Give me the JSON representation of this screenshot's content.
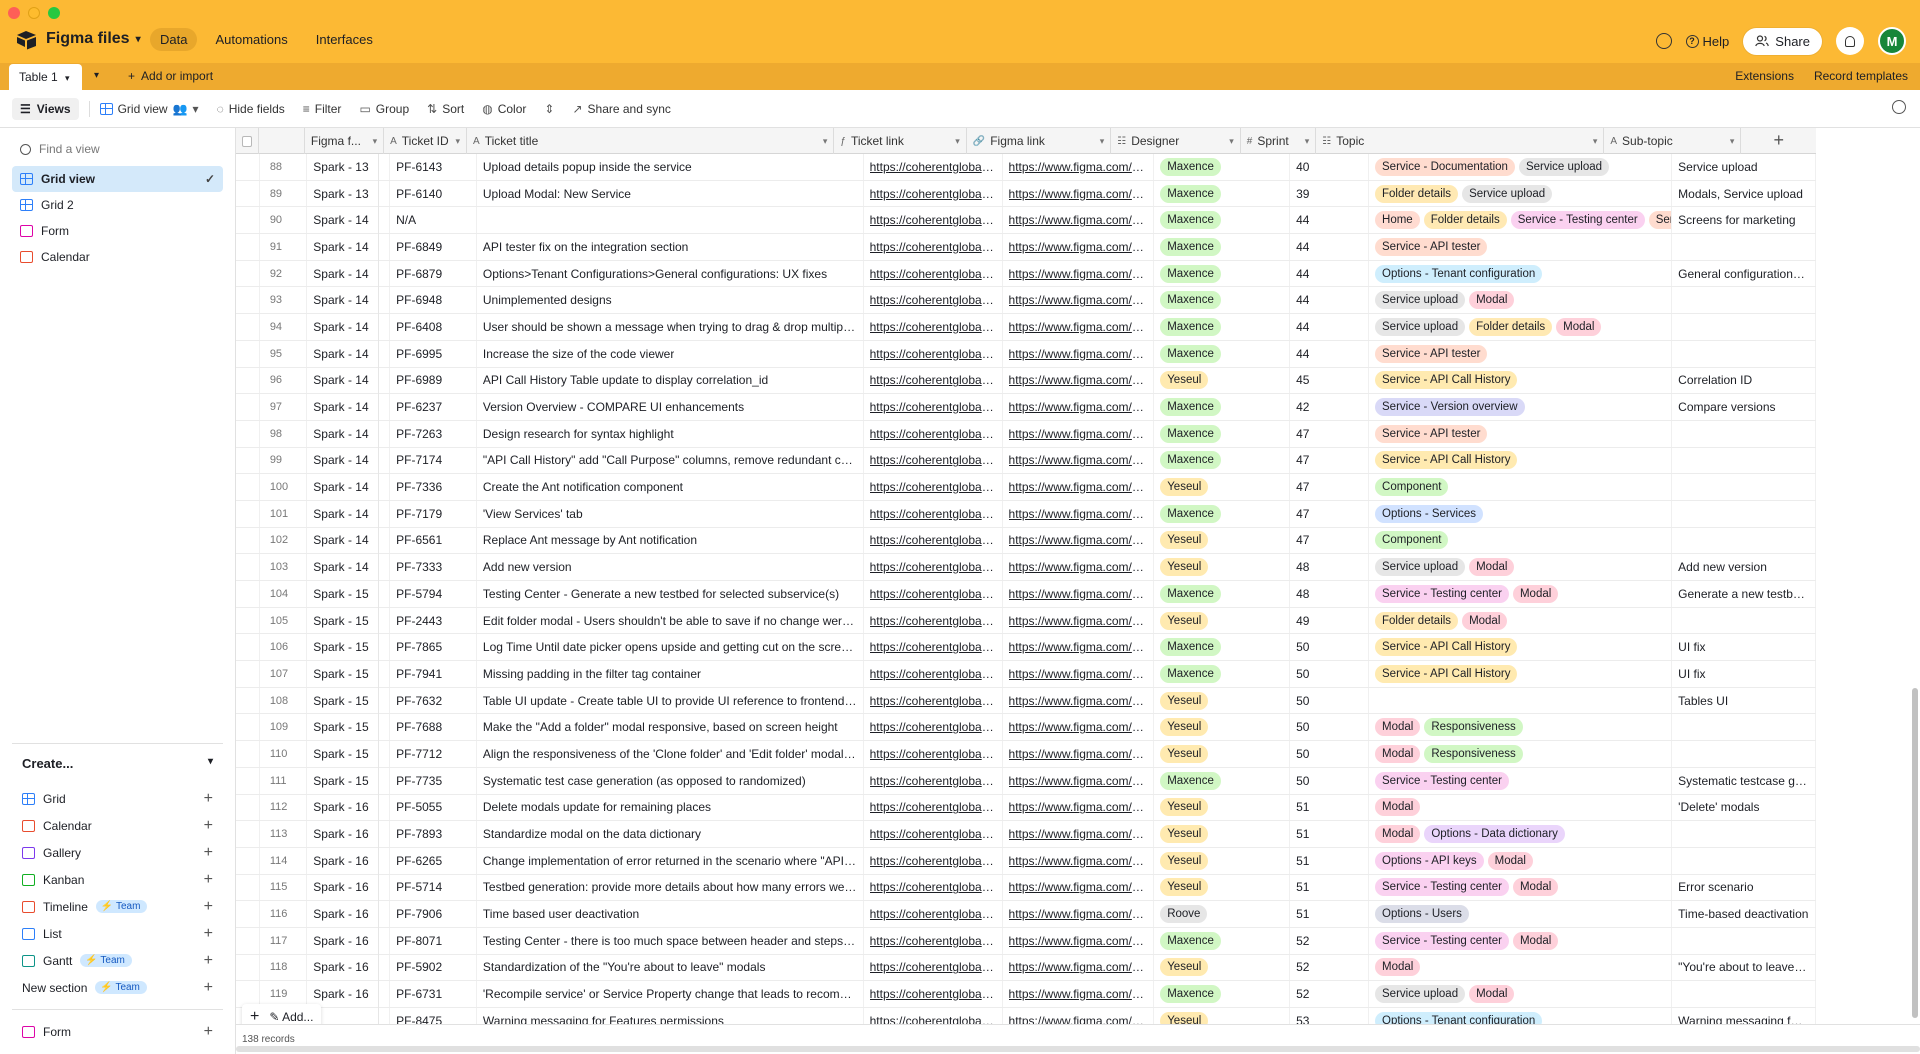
{
  "app": {
    "base_name": "Figma files",
    "nav": [
      "Data",
      "Automations",
      "Interfaces"
    ],
    "help": "Help",
    "share": "Share",
    "avatar": "M"
  },
  "tabs": {
    "table": "Table 1",
    "add_import": "Add or import",
    "extensions": "Extensions",
    "record_templates": "Record templates"
  },
  "toolbar": {
    "views": "Views",
    "grid_view": "Grid view",
    "hide_fields": "Hide fields",
    "filter": "Filter",
    "group": "Group",
    "sort": "Sort",
    "color": "Color",
    "share_sync": "Share and sync"
  },
  "sidebar": {
    "find_placeholder": "Find a view",
    "views": [
      {
        "label": "Grid view",
        "type": "grid",
        "active": true
      },
      {
        "label": "Grid 2",
        "type": "grid"
      },
      {
        "label": "Form",
        "type": "form"
      },
      {
        "label": "Calendar",
        "type": "cal"
      }
    ],
    "create_title": "Create...",
    "create_items": [
      {
        "label": "Grid",
        "type": "grid"
      },
      {
        "label": "Calendar",
        "type": "cal"
      },
      {
        "label": "Gallery",
        "type": "gallery"
      },
      {
        "label": "Kanban",
        "type": "kanban"
      },
      {
        "label": "Timeline",
        "type": "timeline",
        "badge": "Team"
      },
      {
        "label": "List",
        "type": "list"
      },
      {
        "label": "Gantt",
        "type": "gantt",
        "badge": "Team"
      },
      {
        "label": "New section",
        "type": "",
        "badge": "Team"
      }
    ],
    "form_item": "Form"
  },
  "columns": [
    "Figma f...",
    "Ticket ID",
    "Ticket title",
    "Ticket link",
    "Figma link",
    "Designer",
    "Sprint",
    "Topic",
    "Sub-topic"
  ],
  "footer": {
    "records": "138 records",
    "add": "Add..."
  },
  "tag_colors": {
    "Service - Documentation": "#ffdccf",
    "Service upload": "#e6e6e6",
    "Folder details": "#ffe9b3",
    "Home": "#ffdbd1",
    "Service - Testing center": "#fad1f0",
    "Service - API tester": "#ffdccf",
    "Options - Tenant configuration": "#cfeefd",
    "Modal": "#fed0da",
    "Service - API Call History": "#ffeab0",
    "Service - Version overview": "#d9d9f7",
    "Component": "#d1f7c4",
    "Options - Services": "#d1e2ff",
    "Responsiveness": "#d1f7c4",
    "Options - Data dictionary": "#ead5fb",
    "Options - API keys": "#fad1f0",
    "Options - Users": "#dbdde8",
    "Servic": "#ffdccf"
  },
  "designer_colors": {
    "Maxence": "#d1f7c4",
    "Yeseul": "#ffeab0",
    "Roove": "#e6e6e6"
  },
  "rows": [
    {
      "n": "88",
      "sprint": "Spark - 13",
      "id": "PF-6143",
      "title": "Upload details popup inside the service",
      "tlink": "https://coherentglobal.a...",
      "flink": "https://www.figma.com/fil...",
      "designer": "Maxence",
      "sp": "40",
      "topic": [
        "Service - Documentation",
        "Service upload"
      ],
      "sub": "Service upload"
    },
    {
      "n": "89",
      "sprint": "Spark - 13",
      "id": "PF-6140",
      "title": "Upload Modal: New Service",
      "tlink": "https://coherentglobal.a...",
      "flink": "https://www.figma.com/fil...",
      "designer": "Maxence",
      "sp": "39",
      "topic": [
        "Folder details",
        "Service upload"
      ],
      "sub": "Modals, Service upload"
    },
    {
      "n": "90",
      "sprint": "Spark - 14",
      "id": "N/A",
      "title": "",
      "tlink": "https://coherentglobal.a...",
      "flink": "https://www.figma.com/fil...",
      "designer": "Maxence",
      "sp": "44",
      "topic": [
        "Home",
        "Folder details",
        "Service - Testing center",
        "Servic"
      ],
      "sub": "Screens for marketing"
    },
    {
      "n": "91",
      "sprint": "Spark - 14",
      "id": "PF-6849",
      "title": "API tester fix on the integration section",
      "tlink": "https://coherentglobal.a...",
      "flink": "https://www.figma.com/fil...",
      "designer": "Maxence",
      "sp": "44",
      "topic": [
        "Service - API tester"
      ],
      "sub": ""
    },
    {
      "n": "92",
      "sprint": "Spark - 14",
      "id": "PF-6879",
      "title": "Options>Tenant Configurations>General configurations: UX fixes",
      "tlink": "https://coherentglobal.a...",
      "flink": "https://www.figma.com/fil...",
      "designer": "Maxence",
      "sp": "44",
      "topic": [
        "Options - Tenant configuration"
      ],
      "sub": "General configurations: U..."
    },
    {
      "n": "93",
      "sprint": "Spark - 14",
      "id": "PF-6948",
      "title": "Unimplemented designs",
      "tlink": "https://coherentglobal.a...",
      "flink": "https://www.figma.com/fil...",
      "designer": "Maxence",
      "sp": "44",
      "topic": [
        "Service upload",
        "Modal"
      ],
      "sub": ""
    },
    {
      "n": "94",
      "sprint": "Spark - 14",
      "id": "PF-6408",
      "title": "User should be shown a message when trying to drag & drop multiple file...",
      "tlink": "https://coherentglobal.a...",
      "flink": "https://www.figma.com/fil...",
      "designer": "Maxence",
      "sp": "44",
      "topic": [
        "Service upload",
        "Folder details",
        "Modal"
      ],
      "sub": ""
    },
    {
      "n": "95",
      "sprint": "Spark - 14",
      "id": "PF-6995",
      "title": "Increase the size of the code viewer",
      "tlink": "https://coherentglobal.a...",
      "flink": "https://www.figma.com/fil...",
      "designer": "Maxence",
      "sp": "44",
      "topic": [
        "Service - API tester"
      ],
      "sub": ""
    },
    {
      "n": "96",
      "sprint": "Spark - 14",
      "id": "PF-6989",
      "title": "API Call History Table update to display correlation_id",
      "tlink": "https://coherentglobal.a...",
      "flink": "https://www.figma.com/fil...",
      "designer": "Yeseul",
      "sp": "45",
      "topic": [
        "Service - API Call History"
      ],
      "sub": "Correlation ID"
    },
    {
      "n": "97",
      "sprint": "Spark - 14",
      "id": "PF-6237",
      "title": "Version Overview - COMPARE UI enhancements",
      "tlink": "https://coherentglobal.a...",
      "flink": "https://www.figma.com/fil...",
      "designer": "Maxence",
      "sp": "42",
      "topic": [
        "Service - Version overview"
      ],
      "sub": "Compare versions"
    },
    {
      "n": "98",
      "sprint": "Spark - 14",
      "id": "PF-7263",
      "title": "Design research for syntax highlight",
      "tlink": "https://coherentglobal.a...",
      "flink": "https://www.figma.com/fil...",
      "designer": "Maxence",
      "sp": "47",
      "topic": [
        "Service - API tester"
      ],
      "sub": ""
    },
    {
      "n": "99",
      "sprint": "Spark - 14",
      "id": "PF-7174",
      "title": "\"API Call History\" add \"Call Purpose\" columns, remove redundant column...",
      "tlink": "https://coherentglobal.a...",
      "flink": "https://www.figma.com/fil...",
      "designer": "Maxence",
      "sp": "47",
      "topic": [
        "Service - API Call History"
      ],
      "sub": ""
    },
    {
      "n": "100",
      "sprint": "Spark - 14",
      "id": "PF-7336",
      "title": "Create the Ant notification component",
      "tlink": "https://coherentglobal.a...",
      "flink": "https://www.figma.com/fil...",
      "designer": "Yeseul",
      "sp": "47",
      "topic": [
        "Component"
      ],
      "sub": ""
    },
    {
      "n": "101",
      "sprint": "Spark - 14",
      "id": "PF-7179",
      "title": "'View Services' tab",
      "tlink": "https://coherentglobal.a...",
      "flink": "https://www.figma.com/fil...",
      "designer": "Maxence",
      "sp": "47",
      "topic": [
        "Options - Services"
      ],
      "sub": ""
    },
    {
      "n": "102",
      "sprint": "Spark - 14",
      "id": "PF-6561",
      "title": "Replace Ant message by Ant notification",
      "tlink": "https://coherentglobal.a...",
      "flink": "https://www.figma.com/fil...",
      "designer": "Yeseul",
      "sp": "47",
      "topic": [
        "Component"
      ],
      "sub": ""
    },
    {
      "n": "103",
      "sprint": "Spark - 14",
      "id": "PF-7333",
      "title": "Add new version",
      "tlink": "https://coherentglobal.a...",
      "flink": "https://www.figma.com/fil...",
      "designer": "Yeseul",
      "sp": "48",
      "topic": [
        "Service upload",
        "Modal"
      ],
      "sub": "Add new version"
    },
    {
      "n": "104",
      "sprint": "Spark - 15",
      "id": "PF-5794",
      "title": "Testing Center - Generate a new testbed for selected subservice(s)",
      "tlink": "https://coherentglobal.a...",
      "flink": "https://www.figma.com/fil...",
      "designer": "Maxence",
      "sp": "48",
      "topic": [
        "Service - Testing center",
        "Modal"
      ],
      "sub": "Generate a new testbed f..."
    },
    {
      "n": "105",
      "sprint": "Spark - 15",
      "id": "PF-2443",
      "title": "Edit folder modal - Users shouldn't be able to save if no change were made",
      "tlink": "https://coherentglobal.a...",
      "flink": "https://www.figma.com/fil...",
      "designer": "Yeseul",
      "sp": "49",
      "topic": [
        "Folder details",
        "Modal"
      ],
      "sub": ""
    },
    {
      "n": "106",
      "sprint": "Spark - 15",
      "id": "PF-7865",
      "title": "Log Time Until date picker opens upside and getting cut on the screen wh...",
      "tlink": "https://coherentglobal.a...",
      "flink": "https://www.figma.com/fil...",
      "designer": "Maxence",
      "sp": "50",
      "topic": [
        "Service - API Call History"
      ],
      "sub": "UI fix"
    },
    {
      "n": "107",
      "sprint": "Spark - 15",
      "id": "PF-7941",
      "title": "Missing padding in the filter tag container",
      "tlink": "https://coherentglobal.a...",
      "flink": "https://www.figma.com/fil...",
      "designer": "Maxence",
      "sp": "50",
      "topic": [
        "Service - API Call History"
      ],
      "sub": "UI fix"
    },
    {
      "n": "108",
      "sprint": "Spark - 15",
      "id": "PF-7632",
      "title": "Table UI update - Create table UI to provide UI reference to frontend team",
      "tlink": "https://coherentglobal.a...",
      "flink": "https://www.figma.com/fil...",
      "designer": "Yeseul",
      "sp": "50",
      "topic": [],
      "sub": "Tables UI"
    },
    {
      "n": "109",
      "sprint": "Spark - 15",
      "id": "PF-7688",
      "title": "Make the \"Add a folder\" modal responsive, based on screen height",
      "tlink": "https://coherentglobal.a...",
      "flink": "https://www.figma.com/fil...",
      "designer": "Yeseul",
      "sp": "50",
      "topic": [
        "Modal",
        "Responsiveness"
      ],
      "sub": ""
    },
    {
      "n": "110",
      "sprint": "Spark - 15",
      "id": "PF-7712",
      "title": "Align the responsiveness of the 'Clone folder' and 'Edit folder' modals wit...",
      "tlink": "https://coherentglobal.a...",
      "flink": "https://www.figma.com/fil...",
      "designer": "Yeseul",
      "sp": "50",
      "topic": [
        "Modal",
        "Responsiveness"
      ],
      "sub": ""
    },
    {
      "n": "111",
      "sprint": "Spark - 15",
      "id": "PF-7735",
      "title": "Systematic test case generation (as opposed to randomized)",
      "tlink": "https://coherentglobal.a...",
      "flink": "https://www.figma.com/fil...",
      "designer": "Maxence",
      "sp": "50",
      "topic": [
        "Service - Testing center"
      ],
      "sub": "Systematic testcase gene..."
    },
    {
      "n": "112",
      "sprint": "Spark - 16",
      "id": "PF-5055",
      "title": "Delete modals update for remaining places",
      "tlink": "https://coherentglobal.a...",
      "flink": "https://www.figma.com/fil...",
      "designer": "Yeseul",
      "sp": "51",
      "topic": [
        "Modal"
      ],
      "sub": "'Delete' modals"
    },
    {
      "n": "113",
      "sprint": "Spark - 16",
      "id": "PF-7893",
      "title": "Standardize modal on the data dictionary",
      "tlink": "https://coherentglobal.a...",
      "flink": "https://www.figma.com/fil...",
      "designer": "Yeseul",
      "sp": "51",
      "topic": [
        "Modal",
        "Options - Data dictionary"
      ],
      "sub": ""
    },
    {
      "n": "114",
      "sprint": "Spark - 16",
      "id": "PF-6265",
      "title": "Change implementation of error returned in the scenario where \"API key a...",
      "tlink": "https://coherentglobal.a...",
      "flink": "https://www.figma.com/fil...",
      "designer": "Yeseul",
      "sp": "51",
      "topic": [
        "Options - API keys",
        "Modal"
      ],
      "sub": ""
    },
    {
      "n": "115",
      "sprint": "Spark - 16",
      "id": "PF-5714",
      "title": "Testbed generation: provide more details about how many errors were det...",
      "tlink": "https://coherentglobal.a...",
      "flink": "https://www.figma.com/fil...",
      "designer": "Yeseul",
      "sp": "51",
      "topic": [
        "Service - Testing center",
        "Modal"
      ],
      "sub": "Error scenario"
    },
    {
      "n": "116",
      "sprint": "Spark - 16",
      "id": "PF-7906",
      "title": "Time based user deactivation",
      "tlink": "https://coherentglobal.a...",
      "flink": "https://www.figma.com/fil...",
      "designer": "Roove",
      "sp": "51",
      "topic": [
        "Options - Users"
      ],
      "sub": "Time-based deactivation"
    },
    {
      "n": "117",
      "sprint": "Spark - 16",
      "id": "PF-8071",
      "title": "Testing Center - there is too much space between header and steps in Ge...",
      "tlink": "https://coherentglobal.a...",
      "flink": "https://www.figma.com/fil...",
      "designer": "Maxence",
      "sp": "52",
      "topic": [
        "Service - Testing center",
        "Modal"
      ],
      "sub": ""
    },
    {
      "n": "118",
      "sprint": "Spark - 16",
      "id": "PF-5902",
      "title": "Standardization of the \"You're about to leave\" modals",
      "tlink": "https://coherentglobal.a...",
      "flink": "https://www.figma.com/fil...",
      "designer": "Yeseul",
      "sp": "52",
      "topic": [
        "Modal"
      ],
      "sub": "\"You're about to leave\" s..."
    },
    {
      "n": "119",
      "sprint": "Spark - 16",
      "id": "PF-6731",
      "title": "'Recompile service' or Service Property change that leads to recompile, m...",
      "tlink": "https://coherentglobal.a...",
      "flink": "https://www.figma.com/fil...",
      "designer": "Maxence",
      "sp": "52",
      "topic": [
        "Service upload",
        "Modal"
      ],
      "sub": ""
    },
    {
      "n": "",
      "sprint": "",
      "id": "PF-8475",
      "title": "Warning messaging for Features permissions",
      "tlink": "https://coherentglobal.a...",
      "flink": "https://www.figma.com/fil...",
      "designer": "Yeseul",
      "sp": "53",
      "topic": [
        "Options - Tenant configuration"
      ],
      "sub": "Warning messaging for F..."
    }
  ]
}
